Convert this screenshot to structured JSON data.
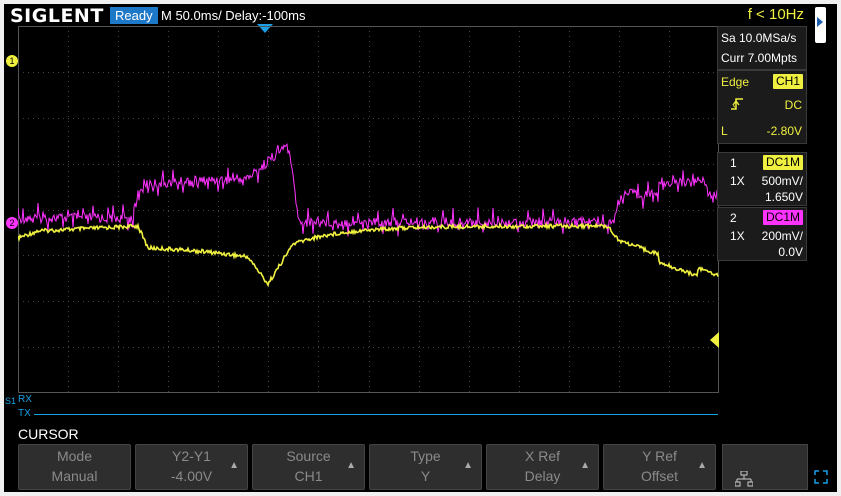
{
  "topbar": {
    "logo": "SIGLENT",
    "status": "Ready",
    "timebase": "M 50.0ms/ Delay:-100ms",
    "frequency": "f < 10Hz"
  },
  "acquisition": {
    "sample_rate": "Sa 10.0MSa/s",
    "memory": "Curr 7.00Mpts"
  },
  "trigger": {
    "type": "Edge",
    "source": "CH1",
    "slope_icon": "rising-edge-icon",
    "coupling": "DC",
    "level_prefix": "L",
    "level": "-2.80V"
  },
  "channels": [
    {
      "number": "1",
      "coupling": "DC1M",
      "probe": "1X",
      "scale": "500mV/",
      "offset": "1.650V",
      "color": "#f0f040"
    },
    {
      "number": "2",
      "coupling": "DC1M",
      "probe": "1X",
      "scale": "200mV/",
      "offset": "0.0V",
      "color": "#ff33ff"
    }
  ],
  "markers": {
    "ch1": "1",
    "ch2": "2",
    "serial": "S1",
    "rx": "RX",
    "tx": "TX"
  },
  "menu": {
    "title": "CURSOR",
    "softkeys": [
      {
        "label": "Mode",
        "value": "Manual",
        "has_arrow": false
      },
      {
        "label": "Y2-Y1",
        "value": "-4.00V",
        "has_arrow": true
      },
      {
        "label": "Source",
        "value": "CH1",
        "has_arrow": true
      },
      {
        "label": "Type",
        "value": "Y",
        "has_arrow": true
      },
      {
        "label": "X Ref",
        "value": "Delay",
        "has_arrow": true
      },
      {
        "label": "Y Ref",
        "value": "Offset",
        "has_arrow": true
      }
    ],
    "network_icon": "network-icon",
    "expand_icon": "expand-icon"
  },
  "colors": {
    "ch1": "#f0f040",
    "ch2": "#ff33ff",
    "accent": "#1e78c8",
    "bus": "#19a0e6"
  }
}
